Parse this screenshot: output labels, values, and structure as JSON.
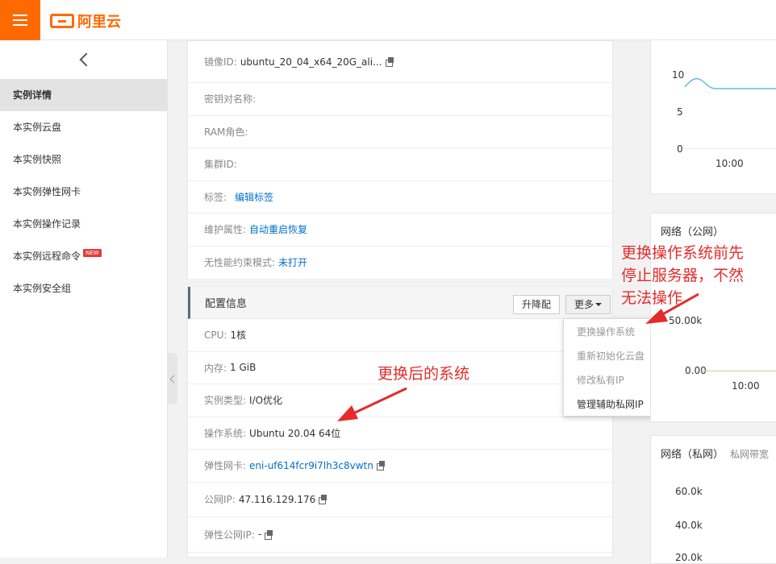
{
  "header": {
    "logo_text": "阿里云",
    "menu_icon": "hamburger-icon"
  },
  "sidebar": {
    "items": [
      {
        "label": "实例详情",
        "active": true
      },
      {
        "label": "本实例云盘"
      },
      {
        "label": "本实例快照"
      },
      {
        "label": "本实例弹性网卡"
      },
      {
        "label": "本实例操作记录"
      },
      {
        "label": "本实例远程命令",
        "badge": "NEW"
      },
      {
        "label": "本实例安全组"
      }
    ]
  },
  "details": {
    "image_id": {
      "label": "镜像ID:",
      "value": "ubuntu_20_04_x64_20G_ali..."
    },
    "keypair": {
      "label": "密钥对名称:"
    },
    "ram_role": {
      "label": "RAM角色:"
    },
    "cluster_id": {
      "label": "集群ID:"
    },
    "tags": {
      "label": "标签:",
      "value": "编辑标签"
    },
    "maintenance": {
      "label": "维护属性:",
      "value": "自动重启恢复"
    },
    "burstable": {
      "label": "无性能约束模式:",
      "value": "未打开"
    }
  },
  "config": {
    "title": "配置信息",
    "upgrade_label": "升降配",
    "more_label": "更多",
    "cpu": {
      "label": "CPU:",
      "value": "1核"
    },
    "memory": {
      "label": "内存:",
      "value": "1 GiB"
    },
    "instance_type": {
      "label": "实例类型:",
      "value": "I/O优化"
    },
    "os": {
      "label": "操作系统:",
      "value": "Ubuntu 20.04 64位"
    },
    "eni": {
      "label": "弹性网卡:",
      "value": "eni-uf614fcr9i7lh3c8vwtn"
    },
    "public_ip": {
      "label": "公网IP:",
      "value": "47.116.129.176"
    },
    "eip": {
      "label": "弹性公网IP:",
      "value": "-"
    }
  },
  "more_menu": {
    "items": [
      {
        "label": "更换操作系统",
        "enabled": false
      },
      {
        "label": "重新初始化云盘",
        "enabled": false
      },
      {
        "label": "修改私有IP",
        "enabled": false
      },
      {
        "label": "管理辅助私网IP",
        "enabled": true
      }
    ]
  },
  "charts": {
    "top": {
      "y_ticks": [
        "10",
        "5",
        "0"
      ],
      "x_tick": "10:00",
      "line_color": "#5bc0de"
    },
    "public_net": {
      "title": "网络（公网）",
      "y_ticks": [
        "50.00k",
        "0.00"
      ],
      "x_tick": "10:00"
    },
    "private_net": {
      "title": "网络（私网）",
      "subtitle": "私网带宽",
      "y_ticks": [
        "60.0k",
        "40.0k",
        "20.0k"
      ]
    }
  },
  "annotations": {
    "stop_first": [
      "更换操作系统前先",
      "停止服务器，不然",
      "无法操作"
    ],
    "after_change": "更换后的系统",
    "color": "#e52b2b"
  }
}
